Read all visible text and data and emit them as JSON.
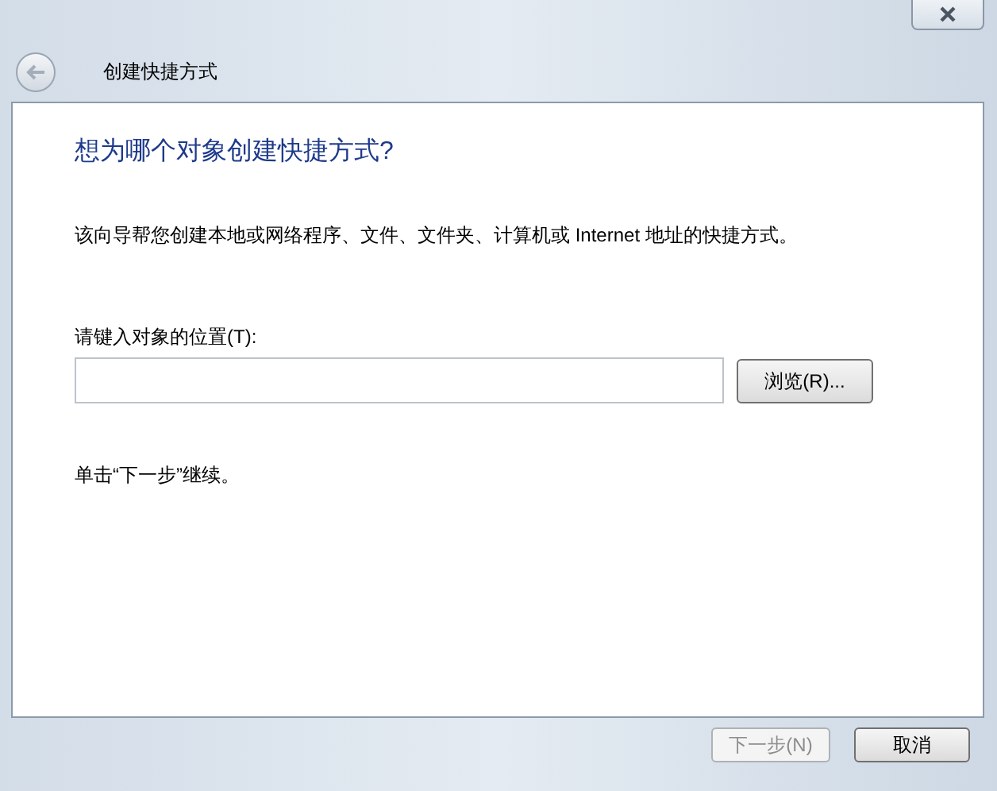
{
  "window": {
    "title": "创建快捷方式"
  },
  "heading": "想为哪个对象创建快捷方式?",
  "description": "该向导帮您创建本地或网络程序、文件、文件夹、计算机或 Internet 地址的快捷方式。",
  "location": {
    "label": "请键入对象的位置(T):",
    "browse_button": "浏览(R)..."
  },
  "hint": "单击“下一步”继续。",
  "buttons": [
    {
      "label": "下一步(N)",
      "disabled": true
    },
    {
      "label": "取消",
      "disabled": false
    }
  ]
}
